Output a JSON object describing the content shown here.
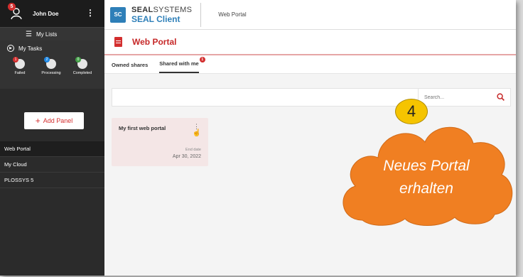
{
  "user": {
    "name": "John Doe",
    "badge": "5"
  },
  "sidebar": {
    "my_lists": "My Lists",
    "my_tasks": "My Tasks",
    "tasks": [
      {
        "label": "Failed",
        "count": "1",
        "color": "#d32f2f"
      },
      {
        "label": "Processing",
        "count": "2",
        "color": "#1e88e5"
      },
      {
        "label": "Completed",
        "count": "0",
        "color": "#43a047"
      }
    ],
    "add_panel": "Add Panel",
    "nav": [
      "Web Portal",
      "My Cloud",
      "PLOSSYS 5"
    ]
  },
  "brand": {
    "bold": "SEAL",
    "light": "SYSTEMS",
    "product": "SEAL Client"
  },
  "breadcrumb": "Web Portal",
  "page_title": "Web Portal",
  "tabs": [
    {
      "label": "Owned shares"
    },
    {
      "label": "Shared with me",
      "badge": "1"
    }
  ],
  "search": {
    "placeholder": "Search..."
  },
  "card": {
    "title": "My first web portal",
    "end_label": "End date",
    "end_date": "Apr 30, 2022"
  },
  "callout": {
    "step": "4",
    "line1": "Neues Portal",
    "line2": "erhalten"
  }
}
